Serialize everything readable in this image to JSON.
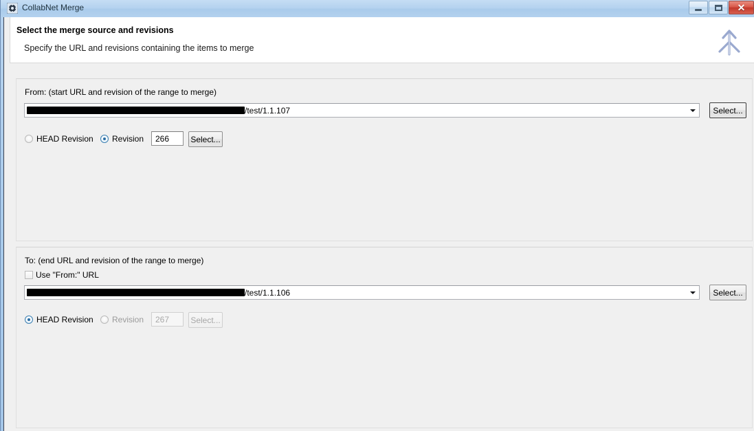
{
  "window": {
    "title": "CollabNet Merge",
    "icon": "gear-icon",
    "controls": {
      "minimize": "Minimize",
      "maximize": "Maximize",
      "close": "Close"
    }
  },
  "header": {
    "title": "Select the merge source and revisions",
    "subtitle": "Specify the URL and revisions containing the items to merge",
    "icon": "merge-arrow-icon"
  },
  "from_section": {
    "legend": "From: (start URL and revision of the range to merge)",
    "url_combo": {
      "redacted_prefix": true,
      "visible_text": "/test/1.1.107"
    },
    "select_url_button": "Select...",
    "head_revision_label": "HEAD Revision",
    "head_revision_selected": false,
    "revision_label": "Revision",
    "revision_selected": true,
    "revision_value": "266",
    "select_revision_button": "Select...",
    "revision_enabled": true
  },
  "to_section": {
    "legend": "To: (end URL and revision of the range to merge)",
    "use_from_url_label": "Use \"From:\" URL",
    "use_from_url_checked": false,
    "url_combo": {
      "redacted_prefix": true,
      "visible_text": "/test/1.1.106"
    },
    "select_url_button": "Select...",
    "head_revision_label": "HEAD Revision",
    "head_revision_selected": true,
    "revision_label": "Revision",
    "revision_selected": false,
    "revision_value": "267",
    "select_revision_button": "Select...",
    "revision_enabled": false
  },
  "colors": {
    "titlebar": "#b0cfed",
    "close_button": "#c2392c",
    "accent_radio": "#2c6da3",
    "header_bg": "#ffffff",
    "dialog_bg": "#f0f0f0"
  }
}
